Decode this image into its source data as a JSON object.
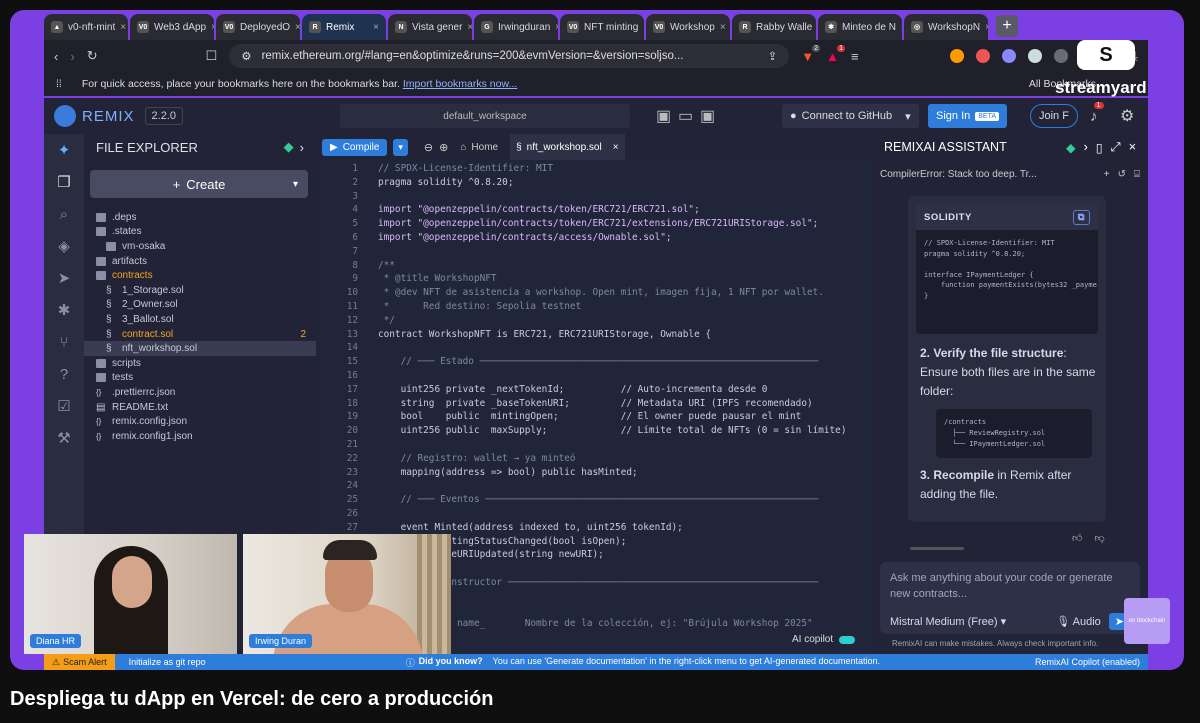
{
  "browser": {
    "tabs": [
      {
        "label": "v0-nft-mint",
        "fav": "▲"
      },
      {
        "label": "Web3 dApp",
        "fav": "V0"
      },
      {
        "label": "DeployedO",
        "fav": "V0"
      },
      {
        "label": "Remix",
        "fav": "R"
      },
      {
        "label": "Vista gener",
        "fav": "N"
      },
      {
        "label": "Irwingduran",
        "fav": "G"
      },
      {
        "label": "NFT minting",
        "fav": "V0"
      },
      {
        "label": "Workshop",
        "fav": "V0"
      },
      {
        "label": "Rabby Walle",
        "fav": "R"
      },
      {
        "label": "Minteo de N",
        "fav": "✱"
      },
      {
        "label": "WorkshopN",
        "fav": "◎"
      }
    ],
    "url": "remix.ethereum.org/#lang=en&optimize&runs=200&evmVersion=&version=soljso...",
    "bookmarks_hint": "For quick access, place your bookmarks here on the bookmarks bar.",
    "import_link": "Import bookmarks now...",
    "all_bookmarks": "All Bookmarks",
    "brave_badge": "2",
    "ext_badge": "1"
  },
  "remix": {
    "brand": "REMIX",
    "version": "2.2.0",
    "workspace": "default_workspace",
    "github": "Connect to GitHub",
    "signin": "Sign In",
    "beta": "BETA",
    "join": "Join F",
    "bell_count": "1"
  },
  "explorer": {
    "title": "FILE EXPLORER",
    "create": "Create",
    "items": [
      {
        "name": ".deps",
        "type": "folder",
        "indent": 0
      },
      {
        "name": ".states",
        "type": "folder",
        "indent": 0
      },
      {
        "name": "vm-osaka",
        "type": "folder",
        "indent": 1
      },
      {
        "name": "artifacts",
        "type": "folder",
        "indent": 0
      },
      {
        "name": "contracts",
        "type": "folder-open",
        "indent": 0
      },
      {
        "name": "1_Storage.sol",
        "type": "file",
        "indent": 1
      },
      {
        "name": "2_Owner.sol",
        "type": "file",
        "indent": 1
      },
      {
        "name": "3_Ballot.sol",
        "type": "file",
        "indent": 1
      },
      {
        "name": "contract.sol",
        "type": "file-warn",
        "indent": 1,
        "badge": "2"
      },
      {
        "name": "nft_workshop.sol",
        "type": "file-active",
        "indent": 1
      },
      {
        "name": "scripts",
        "type": "folder",
        "indent": 0
      },
      {
        "name": "tests",
        "type": "folder",
        "indent": 0
      },
      {
        "name": ".prettierrc.json",
        "type": "json",
        "indent": 0
      },
      {
        "name": "README.txt",
        "type": "txt",
        "indent": 0
      },
      {
        "name": "remix.config.json",
        "type": "json",
        "indent": 0
      },
      {
        "name": "remix.config1.json",
        "type": "json",
        "indent": 0
      }
    ]
  },
  "editor": {
    "compile": "Compile",
    "home_tab": "Home",
    "file_tab": "nft_workshop.sol",
    "lines": [
      {
        "n": "1",
        "t": "// SPDX-License-Identifier: MIT",
        "c": "comment"
      },
      {
        "n": "2",
        "t": "pragma solidity ^0.8.20;",
        "c": "code"
      },
      {
        "n": "3",
        "t": "",
        "c": "code"
      },
      {
        "n": "4",
        "t": "import \"@openzeppelin/contracts/token/ERC721/ERC721.sol\";",
        "c": "import"
      },
      {
        "n": "5",
        "t": "import \"@openzeppelin/contracts/token/ERC721/extensions/ERC721URIStorage.sol\";",
        "c": "import"
      },
      {
        "n": "6",
        "t": "import \"@openzeppelin/contracts/access/Ownable.sol\";",
        "c": "import"
      },
      {
        "n": "7",
        "t": "",
        "c": "code"
      },
      {
        "n": "8",
        "t": "/**",
        "c": "comment"
      },
      {
        "n": "9",
        "t": " * @title WorkshopNFT",
        "c": "comment"
      },
      {
        "n": "10",
        "t": " * @dev NFT de asistencia a workshop. Open mint, imagen fija, 1 NFT por wallet.",
        "c": "comment"
      },
      {
        "n": "11",
        "t": " *      Red destino: Sepolia testnet",
        "c": "comment"
      },
      {
        "n": "12",
        "t": " */",
        "c": "comment"
      },
      {
        "n": "13",
        "t": "contract WorkshopNFT is ERC721, ERC721URIStorage, Ownable {",
        "c": "code"
      },
      {
        "n": "14",
        "t": "",
        "c": "code"
      },
      {
        "n": "15",
        "t": "    // ─── Estado ────────────────────────────────────────────────────────────",
        "c": "comment"
      },
      {
        "n": "16",
        "t": "",
        "c": "code"
      },
      {
        "n": "17",
        "t": "    uint256 private _nextTokenId;          // Auto-incrementa desde 0",
        "c": "code"
      },
      {
        "n": "18",
        "t": "    string  private _baseTokenURI;         // Metadata URI (IPFS recomendado)",
        "c": "code"
      },
      {
        "n": "19",
        "t": "    bool    public  mintingOpen;           // El owner puede pausar el mint",
        "c": "code"
      },
      {
        "n": "20",
        "t": "    uint256 public  maxSupply;             // Límite total de NFTs (0 = sin límite)",
        "c": "code"
      },
      {
        "n": "21",
        "t": "",
        "c": "code"
      },
      {
        "n": "22",
        "t": "    // Registro: wallet → ya minteó",
        "c": "comment"
      },
      {
        "n": "23",
        "t": "    mapping(address => bool) public hasMinted;",
        "c": "code"
      },
      {
        "n": "24",
        "t": "",
        "c": "code"
      },
      {
        "n": "25",
        "t": "    // ─── Eventos ───────────────────────────────────────────────────────────",
        "c": "comment"
      },
      {
        "n": "26",
        "t": "",
        "c": "code"
      },
      {
        "n": "27",
        "t": "    event Minted(address indexed to, uint256 tokenId);",
        "c": "code"
      },
      {
        "n": "28",
        "t": "    event MintingStatusChanged(bool isOpen);",
        "c": "code"
      },
      {
        "n": "29",
        "t": "    event BaseURIUpdated(string newURI);",
        "c": "code"
      },
      {
        "n": "30",
        "t": "",
        "c": "code"
      },
      {
        "n": "31",
        "t": "    // ─── Constructor ───────────────────────────────────────────────────────",
        "c": "comment"
      },
      {
        "n": "32",
        "t": "",
        "c": "code"
      },
      {
        "n": "33",
        "t": "    /**",
        "c": "comment"
      },
      {
        "n": "34",
        "t": "     * @param name_       Nombre de la colección, ej: \"Brújula Workshop 2025\"",
        "c": "comment"
      }
    ]
  },
  "ai": {
    "title": "REMIXAI ASSISTANT",
    "thread": "CompilerError: Stack too deep. Tr...",
    "sol_label": "SOLIDITY",
    "sol_code": "// SPDX-License-Identifier: MIT\npragma solidity ^0.8.20;\n\ninterface IPaymentLedger {\n    function paymentExists(bytes32 _payme\n}",
    "step2_num": "2.",
    "step2_bold": "Verify the file structure",
    "step2_rest": ": Ensure both files are in the same folder:",
    "tree_code": "/contracts\n  ├── ReviewRegistry.sol\n  └── IPaymentLedger.sol",
    "step3_num": "3.",
    "step3_bold": "Recompile",
    "step3_rest": " in Remix after adding the file.",
    "placeholder": "Ask me anything about your code or generate new contracts...",
    "model": "Mistral Medium (Free)",
    "audio": "Audio",
    "disclaimer": "RemixAI can make mistakes. Always check important info.",
    "copilot": "AI copilot"
  },
  "status": {
    "scam": "Scam Alert",
    "git": "Initialize as git repo",
    "dyk": "Did you know?",
    "tip": "You can use 'Generate documentation' in the right-click menu to get AI-generated documentation.",
    "copilot_state": "RemixAI Copilot (enabled)"
  },
  "cams": {
    "left_name": "Diana HR",
    "right_name": "Irwing Duran"
  },
  "overlay": {
    "streamyard": "streamyard",
    "corner_badge": "en blockchain"
  },
  "caption": "Despliega tu dApp en Vercel: de cero a producción"
}
